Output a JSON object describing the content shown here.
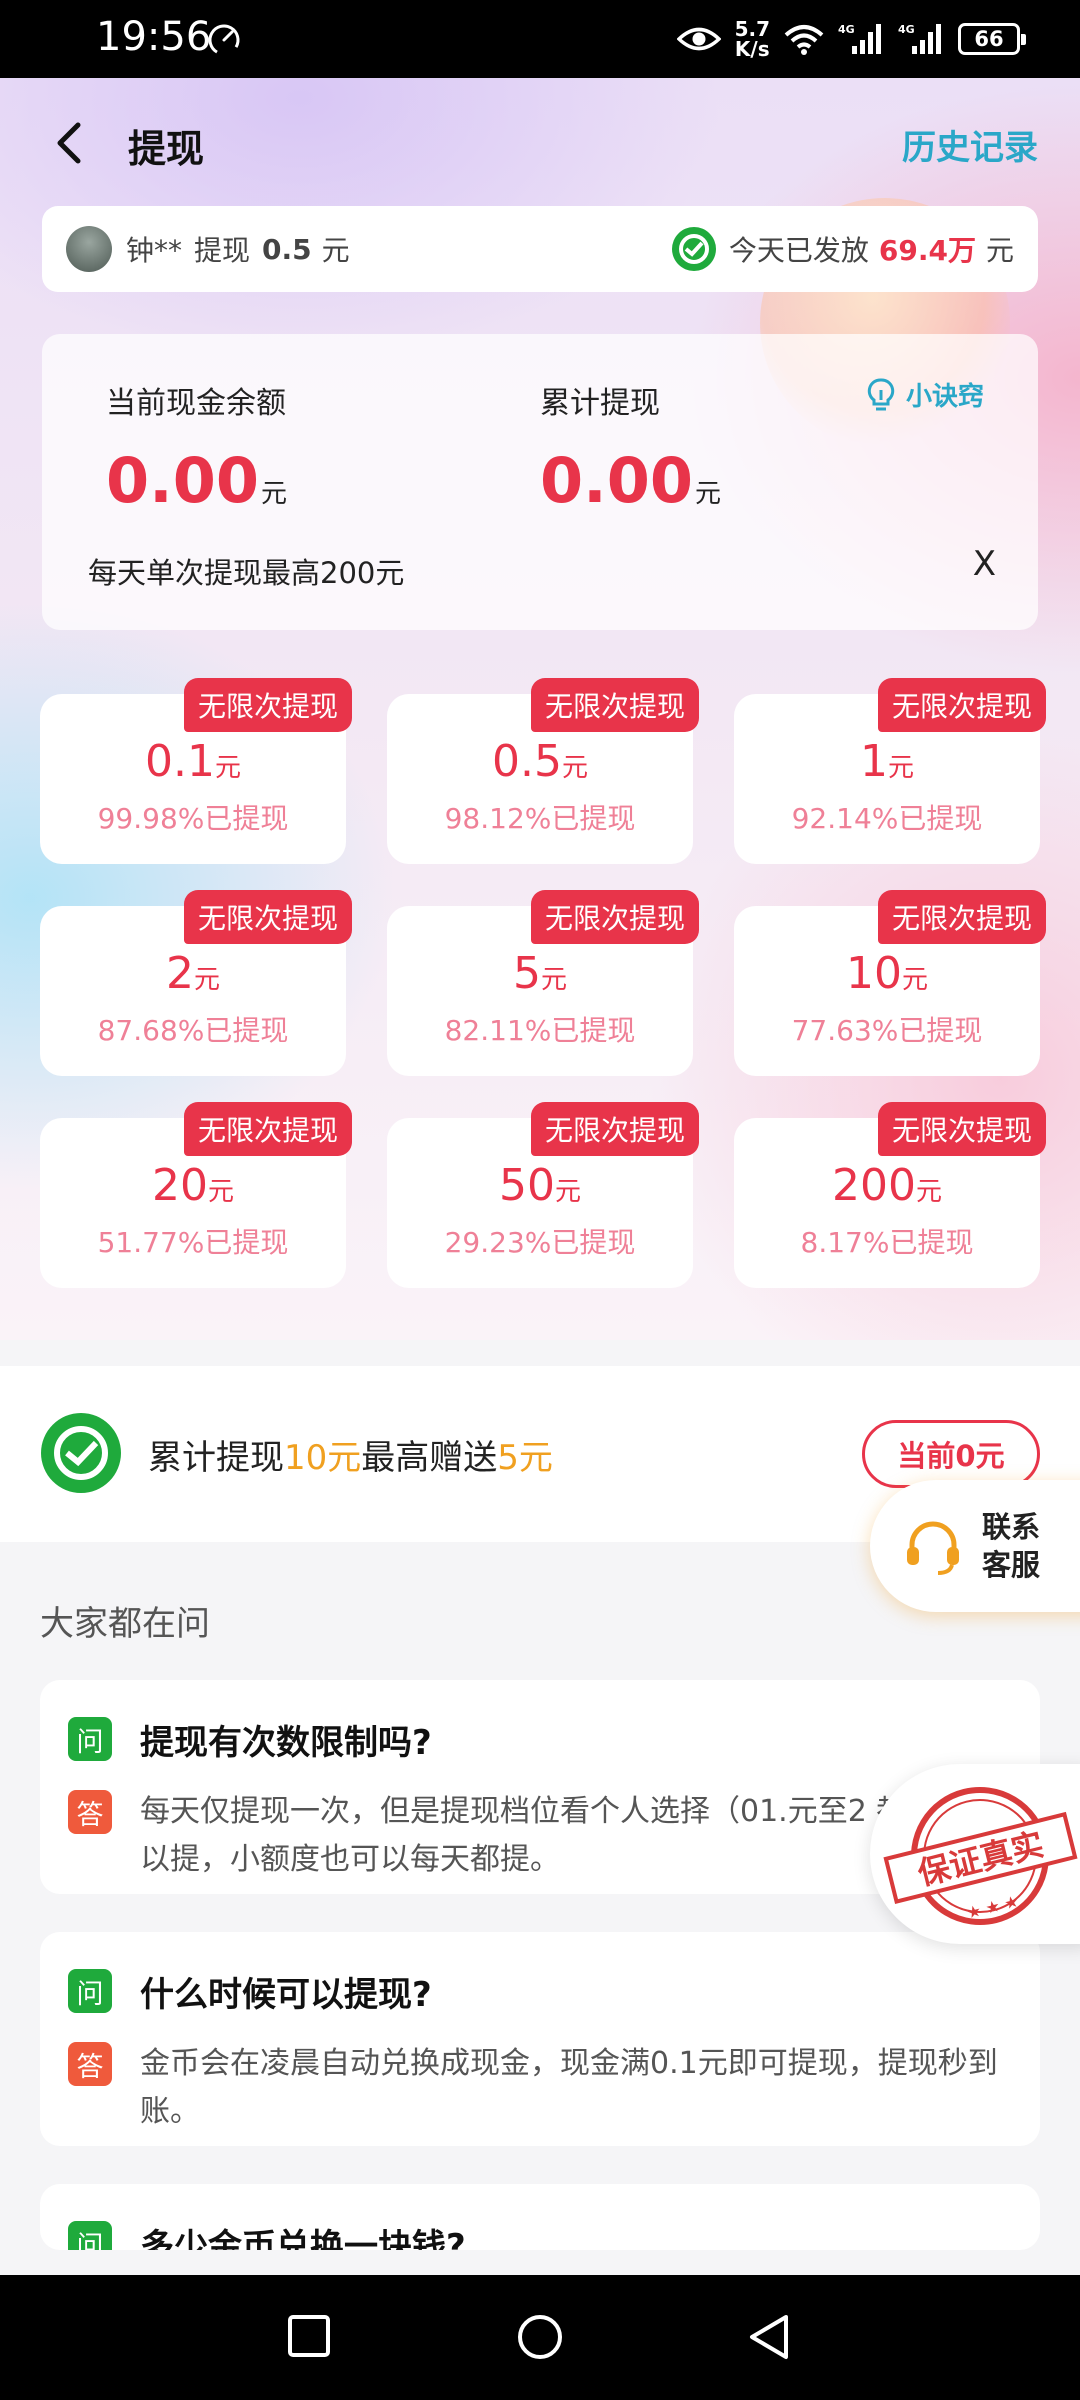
{
  "status_bar": {
    "time": "19:56",
    "speed_value": "5.7",
    "speed_unit": "K/s",
    "signal1_label": "4G",
    "signal2_label": "4G",
    "battery": "66"
  },
  "header": {
    "title": "提现",
    "history_link": "历史记录"
  },
  "ticker": {
    "user": "钟**",
    "action": "提现",
    "amount": "0.5",
    "unit": "元",
    "today_prefix": "今天已发放",
    "today_amount": "69.4万",
    "today_unit": "元"
  },
  "balance": {
    "current_label": "当前现金余额",
    "current_value": "0.00",
    "total_label": "累计提现",
    "total_value": "0.00",
    "unit": "元",
    "tips_label": "小诀窍",
    "limit_note": "每天单次提现最高200元",
    "close_label": "X"
  },
  "options": [
    {
      "badge": "无限次提现",
      "amount": "0.1",
      "unit": "元",
      "rate": "99.98%已提现"
    },
    {
      "badge": "无限次提现",
      "amount": "0.5",
      "unit": "元",
      "rate": "98.12%已提现"
    },
    {
      "badge": "无限次提现",
      "amount": "1",
      "unit": "元",
      "rate": "92.14%已提现"
    },
    {
      "badge": "无限次提现",
      "amount": "2",
      "unit": "元",
      "rate": "87.68%已提现"
    },
    {
      "badge": "无限次提现",
      "amount": "5",
      "unit": "元",
      "rate": "82.11%已提现"
    },
    {
      "badge": "无限次提现",
      "amount": "10",
      "unit": "元",
      "rate": "77.63%已提现"
    },
    {
      "badge": "无限次提现",
      "amount": "20",
      "unit": "元",
      "rate": "51.77%已提现"
    },
    {
      "badge": "无限次提现",
      "amount": "50",
      "unit": "元",
      "rate": "29.23%已提现"
    },
    {
      "badge": "无限次提现",
      "amount": "200",
      "unit": "元",
      "rate": "8.17%已提现"
    }
  ],
  "promo": {
    "part1": "累计提现",
    "highlight1": "10元",
    "part2": "最高赠送",
    "highlight2": "5元",
    "current_button": "当前0元"
  },
  "service": {
    "line1": "联系",
    "line2": "客服"
  },
  "faq": {
    "title": "大家都在问",
    "q_tag": "问",
    "a_tag": "答",
    "items": [
      {
        "question": "提现有次数限制吗?",
        "answer": "每天仅提现一次，但是提现档位看个人选择（01.元至2 都可以提，小额度也可以每天都提。"
      },
      {
        "question": "什么时候可以提现?",
        "answer": "金币会在凌晨自动兑换成现金，现金满0.1元即可提现，提现秒到账。"
      },
      {
        "question": "多少金币兑换一块钱?",
        "answer": ""
      }
    ]
  },
  "stamp": {
    "text": "保证真实"
  },
  "colors": {
    "accent_red": "#e8344a",
    "accent_cyan": "#2aa7c8",
    "wechat_green": "#1faa3c",
    "highlight_orange": "#f0a020"
  }
}
